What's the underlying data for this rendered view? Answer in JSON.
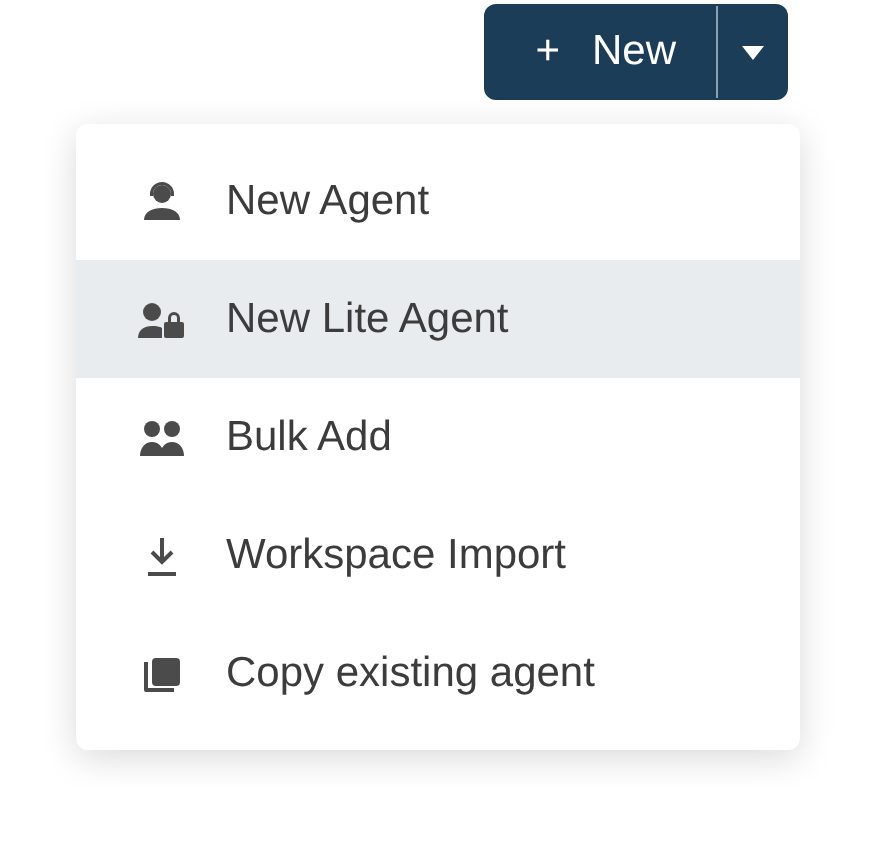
{
  "new_button": {
    "icon": "+",
    "label": "New"
  },
  "menu": {
    "items": [
      {
        "kind": "headset-person",
        "label": "New Agent",
        "selected": false
      },
      {
        "kind": "person-lock",
        "label": "New Lite Agent",
        "selected": true
      },
      {
        "kind": "people",
        "label": "Bulk Add",
        "selected": false
      },
      {
        "kind": "download",
        "label": "Workspace Import",
        "selected": false
      },
      {
        "kind": "copy",
        "label": "Copy existing agent",
        "selected": false
      }
    ]
  }
}
